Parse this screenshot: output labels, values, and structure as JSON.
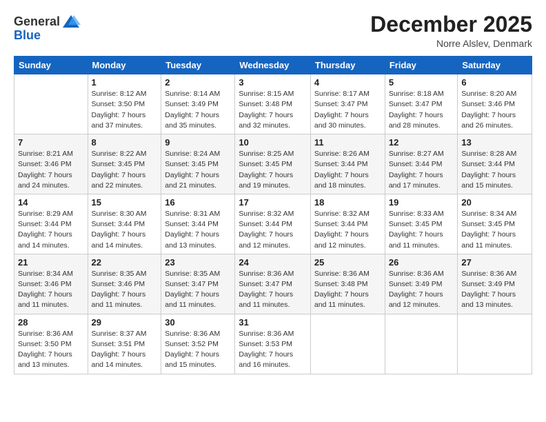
{
  "logo": {
    "general": "General",
    "blue": "Blue"
  },
  "header": {
    "month_year": "December 2025",
    "location": "Norre Alslev, Denmark"
  },
  "days_of_week": [
    "Sunday",
    "Monday",
    "Tuesday",
    "Wednesday",
    "Thursday",
    "Friday",
    "Saturday"
  ],
  "weeks": [
    [
      {
        "day": "",
        "sunrise": "",
        "sunset": "",
        "daylight": ""
      },
      {
        "day": "1",
        "sunrise": "Sunrise: 8:12 AM",
        "sunset": "Sunset: 3:50 PM",
        "daylight": "Daylight: 7 hours and 37 minutes."
      },
      {
        "day": "2",
        "sunrise": "Sunrise: 8:14 AM",
        "sunset": "Sunset: 3:49 PM",
        "daylight": "Daylight: 7 hours and 35 minutes."
      },
      {
        "day": "3",
        "sunrise": "Sunrise: 8:15 AM",
        "sunset": "Sunset: 3:48 PM",
        "daylight": "Daylight: 7 hours and 32 minutes."
      },
      {
        "day": "4",
        "sunrise": "Sunrise: 8:17 AM",
        "sunset": "Sunset: 3:47 PM",
        "daylight": "Daylight: 7 hours and 30 minutes."
      },
      {
        "day": "5",
        "sunrise": "Sunrise: 8:18 AM",
        "sunset": "Sunset: 3:47 PM",
        "daylight": "Daylight: 7 hours and 28 minutes."
      },
      {
        "day": "6",
        "sunrise": "Sunrise: 8:20 AM",
        "sunset": "Sunset: 3:46 PM",
        "daylight": "Daylight: 7 hours and 26 minutes."
      }
    ],
    [
      {
        "day": "7",
        "sunrise": "Sunrise: 8:21 AM",
        "sunset": "Sunset: 3:46 PM",
        "daylight": "Daylight: 7 hours and 24 minutes."
      },
      {
        "day": "8",
        "sunrise": "Sunrise: 8:22 AM",
        "sunset": "Sunset: 3:45 PM",
        "daylight": "Daylight: 7 hours and 22 minutes."
      },
      {
        "day": "9",
        "sunrise": "Sunrise: 8:24 AM",
        "sunset": "Sunset: 3:45 PM",
        "daylight": "Daylight: 7 hours and 21 minutes."
      },
      {
        "day": "10",
        "sunrise": "Sunrise: 8:25 AM",
        "sunset": "Sunset: 3:45 PM",
        "daylight": "Daylight: 7 hours and 19 minutes."
      },
      {
        "day": "11",
        "sunrise": "Sunrise: 8:26 AM",
        "sunset": "Sunset: 3:44 PM",
        "daylight": "Daylight: 7 hours and 18 minutes."
      },
      {
        "day": "12",
        "sunrise": "Sunrise: 8:27 AM",
        "sunset": "Sunset: 3:44 PM",
        "daylight": "Daylight: 7 hours and 17 minutes."
      },
      {
        "day": "13",
        "sunrise": "Sunrise: 8:28 AM",
        "sunset": "Sunset: 3:44 PM",
        "daylight": "Daylight: 7 hours and 15 minutes."
      }
    ],
    [
      {
        "day": "14",
        "sunrise": "Sunrise: 8:29 AM",
        "sunset": "Sunset: 3:44 PM",
        "daylight": "Daylight: 7 hours and 14 minutes."
      },
      {
        "day": "15",
        "sunrise": "Sunrise: 8:30 AM",
        "sunset": "Sunset: 3:44 PM",
        "daylight": "Daylight: 7 hours and 14 minutes."
      },
      {
        "day": "16",
        "sunrise": "Sunrise: 8:31 AM",
        "sunset": "Sunset: 3:44 PM",
        "daylight": "Daylight: 7 hours and 13 minutes."
      },
      {
        "day": "17",
        "sunrise": "Sunrise: 8:32 AM",
        "sunset": "Sunset: 3:44 PM",
        "daylight": "Daylight: 7 hours and 12 minutes."
      },
      {
        "day": "18",
        "sunrise": "Sunrise: 8:32 AM",
        "sunset": "Sunset: 3:44 PM",
        "daylight": "Daylight: 7 hours and 12 minutes."
      },
      {
        "day": "19",
        "sunrise": "Sunrise: 8:33 AM",
        "sunset": "Sunset: 3:45 PM",
        "daylight": "Daylight: 7 hours and 11 minutes."
      },
      {
        "day": "20",
        "sunrise": "Sunrise: 8:34 AM",
        "sunset": "Sunset: 3:45 PM",
        "daylight": "Daylight: 7 hours and 11 minutes."
      }
    ],
    [
      {
        "day": "21",
        "sunrise": "Sunrise: 8:34 AM",
        "sunset": "Sunset: 3:46 PM",
        "daylight": "Daylight: 7 hours and 11 minutes."
      },
      {
        "day": "22",
        "sunrise": "Sunrise: 8:35 AM",
        "sunset": "Sunset: 3:46 PM",
        "daylight": "Daylight: 7 hours and 11 minutes."
      },
      {
        "day": "23",
        "sunrise": "Sunrise: 8:35 AM",
        "sunset": "Sunset: 3:47 PM",
        "daylight": "Daylight: 7 hours and 11 minutes."
      },
      {
        "day": "24",
        "sunrise": "Sunrise: 8:36 AM",
        "sunset": "Sunset: 3:47 PM",
        "daylight": "Daylight: 7 hours and 11 minutes."
      },
      {
        "day": "25",
        "sunrise": "Sunrise: 8:36 AM",
        "sunset": "Sunset: 3:48 PM",
        "daylight": "Daylight: 7 hours and 11 minutes."
      },
      {
        "day": "26",
        "sunrise": "Sunrise: 8:36 AM",
        "sunset": "Sunset: 3:49 PM",
        "daylight": "Daylight: 7 hours and 12 minutes."
      },
      {
        "day": "27",
        "sunrise": "Sunrise: 8:36 AM",
        "sunset": "Sunset: 3:49 PM",
        "daylight": "Daylight: 7 hours and 13 minutes."
      }
    ],
    [
      {
        "day": "28",
        "sunrise": "Sunrise: 8:36 AM",
        "sunset": "Sunset: 3:50 PM",
        "daylight": "Daylight: 7 hours and 13 minutes."
      },
      {
        "day": "29",
        "sunrise": "Sunrise: 8:37 AM",
        "sunset": "Sunset: 3:51 PM",
        "daylight": "Daylight: 7 hours and 14 minutes."
      },
      {
        "day": "30",
        "sunrise": "Sunrise: 8:36 AM",
        "sunset": "Sunset: 3:52 PM",
        "daylight": "Daylight: 7 hours and 15 minutes."
      },
      {
        "day": "31",
        "sunrise": "Sunrise: 8:36 AM",
        "sunset": "Sunset: 3:53 PM",
        "daylight": "Daylight: 7 hours and 16 minutes."
      },
      {
        "day": "",
        "sunrise": "",
        "sunset": "",
        "daylight": ""
      },
      {
        "day": "",
        "sunrise": "",
        "sunset": "",
        "daylight": ""
      },
      {
        "day": "",
        "sunrise": "",
        "sunset": "",
        "daylight": ""
      }
    ]
  ]
}
